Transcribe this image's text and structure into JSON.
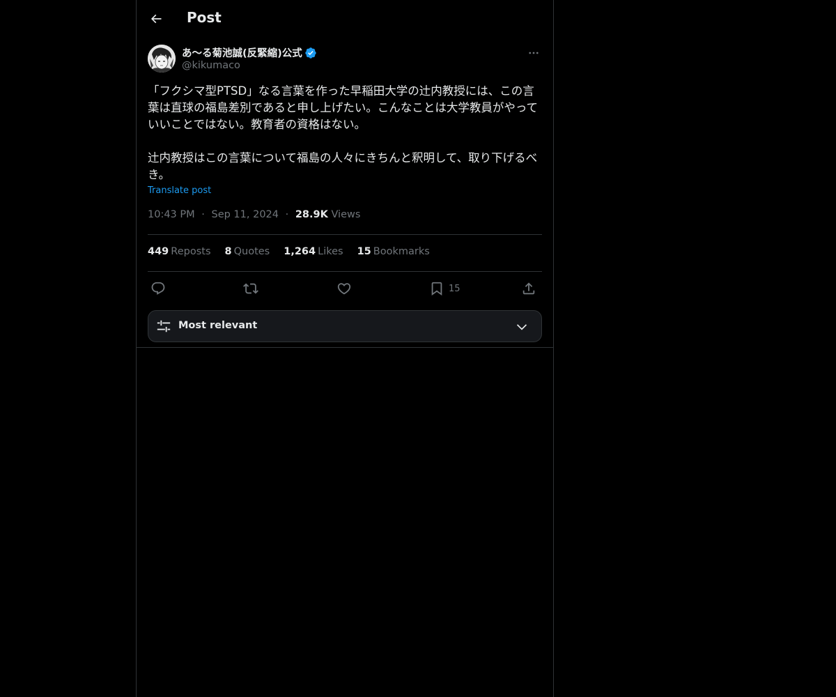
{
  "header": {
    "title": "Post",
    "back_icon": "arrow-left-icon"
  },
  "author": {
    "display_name": "あ〜る菊池誠(反緊縮)公式",
    "handle": "@kikumaco",
    "verified": true,
    "verified_color": "#1d9bf0"
  },
  "post": {
    "text": "「フクシマ型PTSD」なる言葉を作った早稲田大学の辻内教授には、この言葉は直球の福島差別であると申し上げたい。こんなことは大学教員がやっていいことではない。教育者の資格はない。\n\n辻内教授はこの言葉について福島の人々にきちんと釈明して、取り下げるべき。",
    "translate_label": "Translate post",
    "time": "10:43 PM",
    "separator": "·",
    "date": "Sep 11, 2024",
    "views_count": "28.9K",
    "views_label": "Views"
  },
  "stats": {
    "reposts_count": "449",
    "reposts_label": "Reposts",
    "quotes_count": "8",
    "quotes_label": "Quotes",
    "likes_count": "1,264",
    "likes_label": "Likes",
    "bookmarks_count": "15",
    "bookmarks_label": "Bookmarks"
  },
  "actions": {
    "reply_icon": "reply-icon",
    "repost_icon": "repost-icon",
    "like_icon": "heart-icon",
    "bookmark_icon": "bookmark-icon",
    "bookmark_count": "15",
    "share_icon": "share-icon"
  },
  "sort": {
    "label": "Most relevant",
    "icon": "sliders-icon",
    "chevron": "chevron-down-icon"
  },
  "colors": {
    "background": "#000000",
    "text_primary": "#e7e9ea",
    "text_secondary": "#71767b",
    "border": "#2f3336",
    "accent": "#1d9bf0"
  }
}
